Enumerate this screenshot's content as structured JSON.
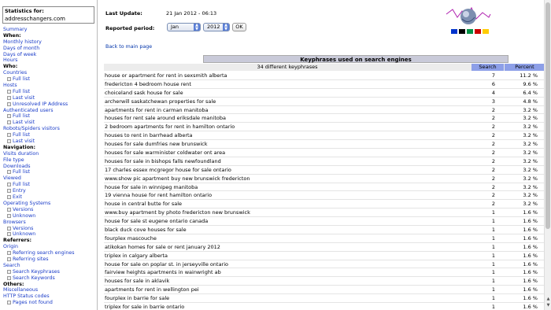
{
  "sidebar": {
    "stats_label": "Statistics for:",
    "site": "addresschangers.com",
    "menu": [
      {
        "text": "Summary",
        "kind": "lnk"
      },
      {
        "text": "When:",
        "kind": "hdr"
      },
      {
        "text": "Monthly history",
        "kind": "lnk"
      },
      {
        "text": "Days of month",
        "kind": "lnk"
      },
      {
        "text": "Days of week",
        "kind": "lnk"
      },
      {
        "text": "Hours",
        "kind": "lnk"
      },
      {
        "text": "Who:",
        "kind": "hdr"
      },
      {
        "text": "Countries",
        "kind": "lnk"
      },
      {
        "text": "Full list",
        "kind": "sub"
      },
      {
        "text": "Hosts",
        "kind": "lnk"
      },
      {
        "text": "Full list",
        "kind": "sub"
      },
      {
        "text": "Last visit",
        "kind": "sub"
      },
      {
        "text": "Unresolved IP Address",
        "kind": "sub"
      },
      {
        "text": "Authenticated users",
        "kind": "lnk"
      },
      {
        "text": "Full list",
        "kind": "sub"
      },
      {
        "text": "Last visit",
        "kind": "sub"
      },
      {
        "text": "Robots/Spiders visitors",
        "kind": "lnk"
      },
      {
        "text": "Full list",
        "kind": "sub"
      },
      {
        "text": "Last visit",
        "kind": "sub"
      },
      {
        "text": "Navigation:",
        "kind": "hdr"
      },
      {
        "text": "Visits duration",
        "kind": "lnk"
      },
      {
        "text": "File type",
        "kind": "lnk"
      },
      {
        "text": "Downloads",
        "kind": "lnk"
      },
      {
        "text": "Full list",
        "kind": "sub"
      },
      {
        "text": "Viewed",
        "kind": "lnk"
      },
      {
        "text": "Full list",
        "kind": "sub"
      },
      {
        "text": "Entry",
        "kind": "sub"
      },
      {
        "text": "Exit",
        "kind": "sub"
      },
      {
        "text": "Operating Systems",
        "kind": "lnk"
      },
      {
        "text": "Versions",
        "kind": "sub"
      },
      {
        "text": "Unknown",
        "kind": "sub"
      },
      {
        "text": "Browsers",
        "kind": "lnk"
      },
      {
        "text": "Versions",
        "kind": "sub"
      },
      {
        "text": "Unknown",
        "kind": "sub"
      },
      {
        "text": "Referrers:",
        "kind": "hdr"
      },
      {
        "text": "Origin",
        "kind": "lnk"
      },
      {
        "text": "Referring search engines",
        "kind": "sub"
      },
      {
        "text": "Referring sites",
        "kind": "sub"
      },
      {
        "text": "Search",
        "kind": "lnk"
      },
      {
        "text": "Search Keyphrases",
        "kind": "sub"
      },
      {
        "text": "Search Keywords",
        "kind": "sub"
      },
      {
        "text": "Others:",
        "kind": "hdr"
      },
      {
        "text": "Miscellaneous",
        "kind": "lnk"
      },
      {
        "text": "HTTP Status codes",
        "kind": "lnk"
      },
      {
        "text": "Pages not found",
        "kind": "sub"
      }
    ]
  },
  "header": {
    "last_update_label": "Last Update:",
    "last_update_value": "21 Jan 2012 - 06:13",
    "period_label": "Reported period:",
    "month": "Jan",
    "year": "2012",
    "ok_label": "OK",
    "back_link": "Back to main page"
  },
  "flags": [
    "#0033cc",
    "#000000",
    "#009246",
    "#cc0000",
    "#ffcc00"
  ],
  "table": {
    "title": "Keyphrases used on search engines",
    "summary": "34 different keyphrases",
    "col_search": "Search",
    "col_percent": "Percent",
    "rows": [
      {
        "k": "house or apartment for rent in sexsmith alberta",
        "s": "7",
        "p": "11.2 %"
      },
      {
        "k": "fredericton 4 bedroom house rent",
        "s": "6",
        "p": "9.6 %"
      },
      {
        "k": "choiceland sask house for sale",
        "s": "4",
        "p": "6.4 %"
      },
      {
        "k": "archerwill saskatchewan properties for sale",
        "s": "3",
        "p": "4.8 %"
      },
      {
        "k": "apartments for rent in carman manitoba",
        "s": "2",
        "p": "3.2 %"
      },
      {
        "k": "houses for rent sale around eriksdale manitoba",
        "s": "2",
        "p": "3.2 %"
      },
      {
        "k": "2 bedroom apartments for rent in hamilton ontario",
        "s": "2",
        "p": "3.2 %"
      },
      {
        "k": "houses to rent in barrhead alberta",
        "s": "2",
        "p": "3.2 %"
      },
      {
        "k": "houses for sale dumfries new brunswick",
        "s": "2",
        "p": "3.2 %"
      },
      {
        "k": "houses for sale warminister coldwater ont area",
        "s": "2",
        "p": "3.2 %"
      },
      {
        "k": "houses for sale in bishops falls newfoundland",
        "s": "2",
        "p": "3.2 %"
      },
      {
        "k": "17 charles essex mcgregor house for sale ontario",
        "s": "2",
        "p": "3.2 %"
      },
      {
        "k": "www.show pic apartment buy new brunswick fredericton",
        "s": "2",
        "p": "3.2 %"
      },
      {
        "k": "house for sale in winnipeg manitoba",
        "s": "2",
        "p": "3.2 %"
      },
      {
        "k": "19 vienna house for rent hamilton ontario",
        "s": "2",
        "p": "3.2 %"
      },
      {
        "k": "house in central butte for sale",
        "s": "2",
        "p": "3.2 %"
      },
      {
        "k": "www.buy apartment by photo fredericton new brunswick",
        "s": "1",
        "p": "1.6 %"
      },
      {
        "k": "house for sale st eugene ontario canada",
        "s": "1",
        "p": "1.6 %"
      },
      {
        "k": "black duck cove houses for sale",
        "s": "1",
        "p": "1.6 %"
      },
      {
        "k": "fourplex mascouche",
        "s": "1",
        "p": "1.6 %"
      },
      {
        "k": "atikokan homes for sale or rent january 2012",
        "s": "1",
        "p": "1.6 %"
      },
      {
        "k": "triplex in calgary alberta",
        "s": "1",
        "p": "1.6 %"
      },
      {
        "k": "house for sale on poplar st. in jerseyville ontario",
        "s": "1",
        "p": "1.6 %"
      },
      {
        "k": "fairview heights apartments in wainwright ab",
        "s": "1",
        "p": "1.6 %"
      },
      {
        "k": "houses for sale in aklavik",
        "s": "1",
        "p": "1.6 %"
      },
      {
        "k": "apartments for rent in wellington pei",
        "s": "1",
        "p": "1.6 %"
      },
      {
        "k": "fourplex in barrie for sale",
        "s": "1",
        "p": "1.6 %"
      },
      {
        "k": "triplex for sale in barrie ontario",
        "s": "1",
        "p": "1.6 %"
      }
    ]
  }
}
